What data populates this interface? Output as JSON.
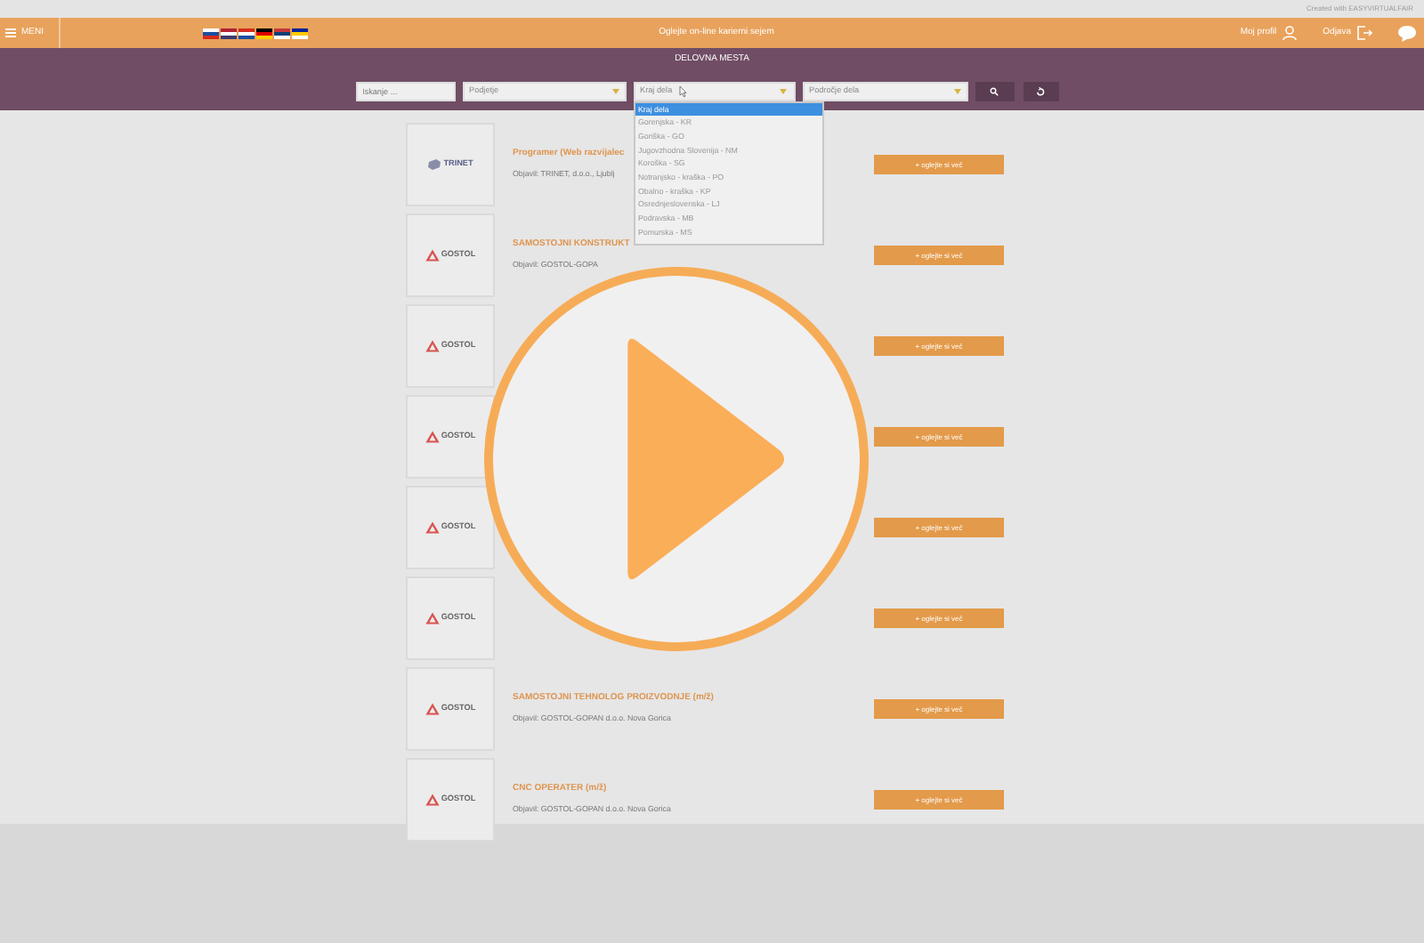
{
  "top_strip": {
    "credit": "Created with EASYVIRTUALFAIR"
  },
  "header": {
    "menu_label": "MENI",
    "title": "Oglejte on-line karierni sejem",
    "links": [
      {
        "label": "Moj profil",
        "kind": "profile"
      },
      {
        "label": "Odjava",
        "kind": "logout"
      }
    ]
  },
  "page_title": "DELOVNA MESTA",
  "filters": [
    {
      "kind": "input",
      "placeholder": "Iskanje ..."
    },
    {
      "kind": "select",
      "value": "Podjetje",
      "open": false
    },
    {
      "kind": "select",
      "value": "Kraj dela",
      "open": true
    },
    {
      "kind": "select",
      "value": "Področje dela",
      "open": false
    }
  ],
  "dropdown_options": [
    {
      "label": "Kraj dela",
      "selected": true
    },
    {
      "label": "Gorenjska - KR",
      "selected": false
    },
    {
      "label": "Goriška - GO",
      "selected": false
    },
    {
      "label": "Jugovzhodna Slovenija - NM",
      "selected": false
    },
    {
      "label": "Koroška - SG",
      "selected": false
    },
    {
      "label": "Notranjsko - kraška - PO",
      "selected": false
    },
    {
      "label": "Obalno - kraška - KP",
      "selected": false
    },
    {
      "label": "Osrednjeslovenska - LJ",
      "selected": false
    },
    {
      "label": "Podravska - MB",
      "selected": false
    },
    {
      "label": "Pomurska - MS",
      "selected": false
    }
  ],
  "jobs": [
    {
      "logo": {
        "kind": "trinet",
        "text": "TRINET"
      },
      "title": "Programer (Web razvijalec",
      "publisher": "Objavil: TRINET, d.o.o., Ljublj",
      "button": "+ oglejte si več"
    },
    {
      "logo": {
        "kind": "gostol",
        "text": "GOSTOL"
      },
      "title": "SAMOSTOJNI KONSTRUKT",
      "publisher": "Objavil: GOSTOL-GOPA",
      "button": "+ oglejte si več"
    },
    {
      "logo": {
        "kind": "gostol",
        "text": "GOSTOL"
      },
      "button": "+ oglejte si več"
    },
    {
      "logo": {
        "kind": "gostol",
        "text": "GOSTOL"
      },
      "button": "+ oglejte si več"
    },
    {
      "logo": {
        "kind": "gostol",
        "text": "GOSTOL"
      },
      "button": "+ oglejte si več"
    },
    {
      "logo": {
        "kind": "gostol",
        "text": "GOSTOL"
      },
      "button": "+ oglejte si več"
    },
    {
      "logo": {
        "kind": "gostol",
        "text": "GOSTOL"
      },
      "title": "SAMOSTOJNI TEHNOLOG PROIZVODNJE (m/ž)",
      "publisher": "Objavil: GOSTOL-GOPAN d.o.o. Nova Gorica",
      "button": "+ oglejte si več"
    },
    {
      "logo": {
        "kind": "gostol",
        "text": "GOSTOL"
      },
      "title": "CNC OPERATER (m/ž)",
      "publisher": "Objavil: GOSTOL-GOPAN d.o.o. Nova Gorica",
      "button": "+ oglejte si več"
    }
  ]
}
